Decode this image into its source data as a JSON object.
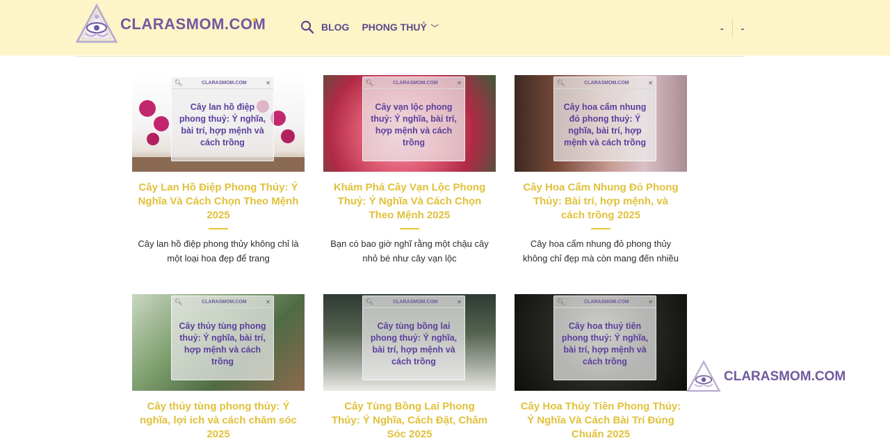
{
  "header": {
    "logo_text": "CLARASMOM.COM",
    "nav": [
      {
        "label": "BLOG"
      },
      {
        "label": "PHONG THUỶ"
      }
    ],
    "right_items": [
      "-",
      "-"
    ]
  },
  "posts": [
    {
      "overlay_site": "CLARASMOM.COM",
      "overlay_text": "Cây lan hồ điệp phong thuỷ: Ý nghĩa, bài trí, hợp mệnh và cách trồng",
      "title": "Cây Lan Hồ Điệp Phong Thủy: Ý Nghĩa Và Cách Chọn Theo Mệnh 2025",
      "excerpt": "Cây lan hồ điệp phong thủy không chỉ là một loại hoa đẹp để trang"
    },
    {
      "overlay_site": "CLARASMOM.COM",
      "overlay_text": "Cây vạn lộc phong thuỷ: Ý nghĩa, bài trí, hợp mệnh và cách trồng",
      "title": "Khám Phá Cây Vạn Lộc Phong Thuỷ: Ý Nghĩa Và Cách Chọn Theo Mệnh 2025",
      "excerpt": "Bạn có bao giờ nghĩ rằng một chậu cây nhỏ bé như cây vạn lộc"
    },
    {
      "overlay_site": "CLARASMOM.COM",
      "overlay_text": "Cây hoa cẩm nhung đỏ phong thuỷ: Ý nghĩa, bài trí, hợp mệnh và cách trồng",
      "title": "Cây Hoa Cẩm Nhung Đỏ Phong Thủy: Bài trí, hợp mệnh, và cách trồng 2025",
      "excerpt": "Cây hoa cẩm nhung đỏ phong thủy không chỉ đẹp mà còn mang đến nhiều"
    },
    {
      "overlay_site": "CLARASMOM.COM",
      "overlay_text": "Cây thủy tùng phong thuỷ: Ý nghĩa, bài trí, hợp mệnh và cách trồng",
      "title": "Cây thủy tùng phong thủy: Ý nghĩa, lợi ích và cách chăm sóc 2025",
      "excerpt": ""
    },
    {
      "overlay_site": "CLARASMOM.COM",
      "overlay_text": "Cây tùng bồng lai phong thuỷ: Ý nghĩa, bài trí, hợp mệnh và cách trồng",
      "title": "Cây Tùng Bồng Lai Phong Thủy: Ý Nghĩa, Cách Đặt, Chăm Sóc 2025",
      "excerpt": ""
    },
    {
      "overlay_site": "CLARASMOM.COM",
      "overlay_text": "Cây hoa thuỷ tiên phong thuỷ: Ý nghĩa, bài trí, hợp mệnh và cách trồng",
      "title": "Cây Hoa Thủy Tiên Phong Thủy: Ý Nghĩa Và Cách Bài Trí Đúng Chuẩn 2025",
      "excerpt": ""
    }
  ],
  "watermark": {
    "text": "CLARASMOM.COM"
  },
  "colors": {
    "header_bg": "#fdf4c8",
    "brand_purple": "#6f5a9e",
    "title_gold": "#e0c13b"
  },
  "icons": [
    "logo-eye-triangle-icon",
    "search-icon",
    "chevron-down-icon",
    "close-icon"
  ]
}
